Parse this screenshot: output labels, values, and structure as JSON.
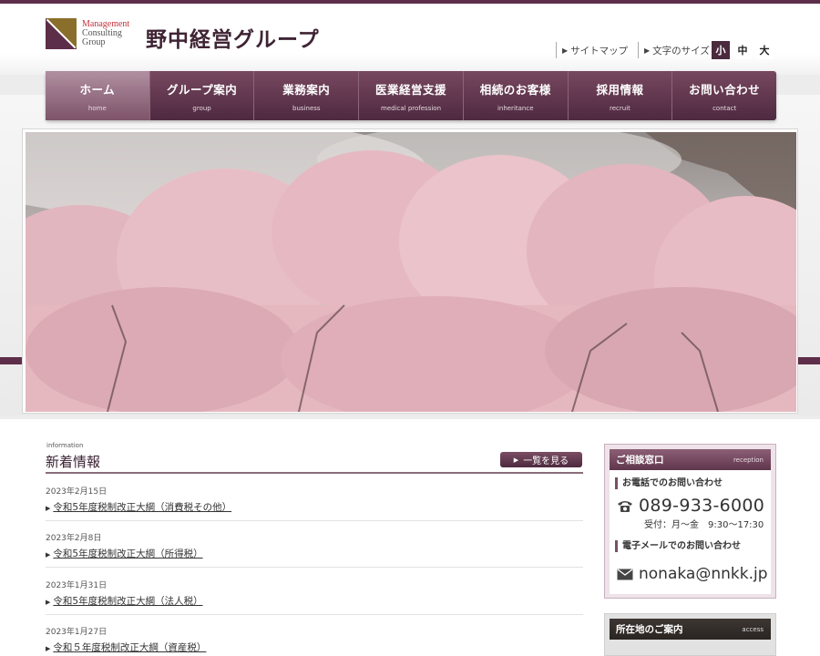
{
  "logo": {
    "en_line1": "Management",
    "en_line2": "Consulting",
    "en_line3": "Group",
    "name": "野中経営グループ"
  },
  "header": {
    "sitemap": "サイトマップ",
    "fontsize_label": "文字のサイズ",
    "font_small": "小",
    "font_medium": "中",
    "font_large": "大"
  },
  "nav": [
    {
      "jp": "ホーム",
      "en": "home"
    },
    {
      "jp": "グループ案内",
      "en": "group"
    },
    {
      "jp": "業務案内",
      "en": "business"
    },
    {
      "jp": "医業経営支援",
      "en": "medical profession"
    },
    {
      "jp": "相続のお客様",
      "en": "inheritance"
    },
    {
      "jp": "採用情報",
      "en": "recruit"
    },
    {
      "jp": "お問い合わせ",
      "en": "contact"
    }
  ],
  "slider": {
    "active_index": 0,
    "count": 8
  },
  "news": {
    "caption": "information",
    "title": "新着情報",
    "more_label": "一覧を見る",
    "items": [
      {
        "date": "2023年2月15日",
        "title": "令和5年度税制改正大綱（消費税その他）"
      },
      {
        "date": "2023年2月8日",
        "title": "令和5年度税制改正大綱（所得税）"
      },
      {
        "date": "2023年1月31日",
        "title": "令和5年度税制改正大綱（法人税）"
      },
      {
        "date": "2023年1月27日",
        "title": "令和５年度税制改正大綱（資産税）"
      }
    ]
  },
  "contact": {
    "title": "ご相談窓口",
    "title_en": "reception",
    "phone_label": "お電話でのお問い合わせ",
    "phone": "089-933-6000",
    "hours": "受付：月〜金　9:30〜17:30",
    "email_label": "電子メールでのお問い合わせ",
    "email": "nonaka@nnkk.jp"
  },
  "access": {
    "title": "所在地のご案内",
    "title_en": "access"
  },
  "colors": {
    "brand": "#5d2e49",
    "accent_gold": "#8a6e2b",
    "logo_red": "#c4323b"
  },
  "icons": {
    "phone": "phone-icon",
    "mail": "mail-icon",
    "arrow": "triangle-right-icon"
  }
}
